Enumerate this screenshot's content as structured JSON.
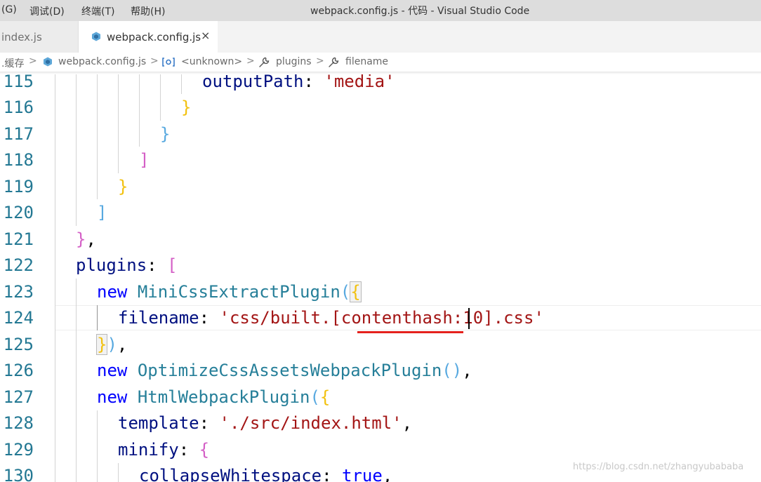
{
  "titlebar": {
    "menu": [
      "(G)",
      "调试(D)",
      "终端(T)",
      "帮助(H)"
    ],
    "title": "webpack.config.js - 代码 - Visual Studio Code"
  },
  "tabs": [
    {
      "label": "index.js",
      "active": false
    },
    {
      "label": "webpack.config.js",
      "active": true,
      "close": "×"
    }
  ],
  "breadcrumb": {
    "items": [
      ".缓存",
      "webpack.config.js",
      "<unknown>",
      "plugins",
      "filename"
    ],
    "icons": [
      "",
      "file-icon",
      "object-icon",
      "wrench-icon",
      "wrench-icon"
    ],
    "separator": ">"
  },
  "editor": {
    "line_numbers": [
      "115",
      "116",
      "117",
      "118",
      "119",
      "120",
      "121",
      "122",
      "123",
      "124",
      "125",
      "126",
      "127",
      "128",
      "129",
      "130"
    ],
    "lines": {
      "l115": {
        "key": "outputPath",
        "colon": ": ",
        "str": "'media'"
      },
      "l116": {
        "b": "}"
      },
      "l117": {
        "b": "}"
      },
      "l118": {
        "b": "]"
      },
      "l119": {
        "b": "}"
      },
      "l120": {
        "b": "]"
      },
      "l121": {
        "b": "}",
        "tail": ","
      },
      "l122": {
        "key": "plugins",
        "colon": ": ",
        "b": "["
      },
      "l123": {
        "kw": "new",
        "cls": "MiniCssExtractPlugin",
        "p": "(",
        "b": "{"
      },
      "l124": {
        "key": "filename",
        "colon": ": ",
        "str_a": "'css/built.[",
        "str_b": "contenthash",
        "str_c": ":10].css'"
      },
      "l125": {
        "b": "}",
        "p": ")",
        "tail": ","
      },
      "l126": {
        "kw": "new",
        "cls": "OptimizeCssAssetsWebpackPlugin",
        "p": "()",
        "tail": ","
      },
      "l127": {
        "kw": "new",
        "cls": "HtmlWebpackPlugin",
        "p": "(",
        "b": "{"
      },
      "l128": {
        "key": "template",
        "colon": ": ",
        "str": "'./src/index.html'",
        "tail": ","
      },
      "l129": {
        "key": "minify",
        "colon": ": ",
        "b": "{"
      },
      "l130": {
        "key": "collapseWhitespace",
        "colon": ": ",
        "kw": "true",
        "tail": ","
      }
    }
  },
  "watermark": "https://blog.csdn.net/zhangyubababa",
  "colors": {
    "key": "#001080",
    "string": "#a31515",
    "keyword": "#0000ff",
    "class": "#267f99",
    "line_number": "#237893",
    "bracket_gold": "#f2c10e",
    "bracket_pink": "#d45fc6",
    "bracket_blue": "#58a9e0",
    "annotation_red": "#e5211d"
  }
}
